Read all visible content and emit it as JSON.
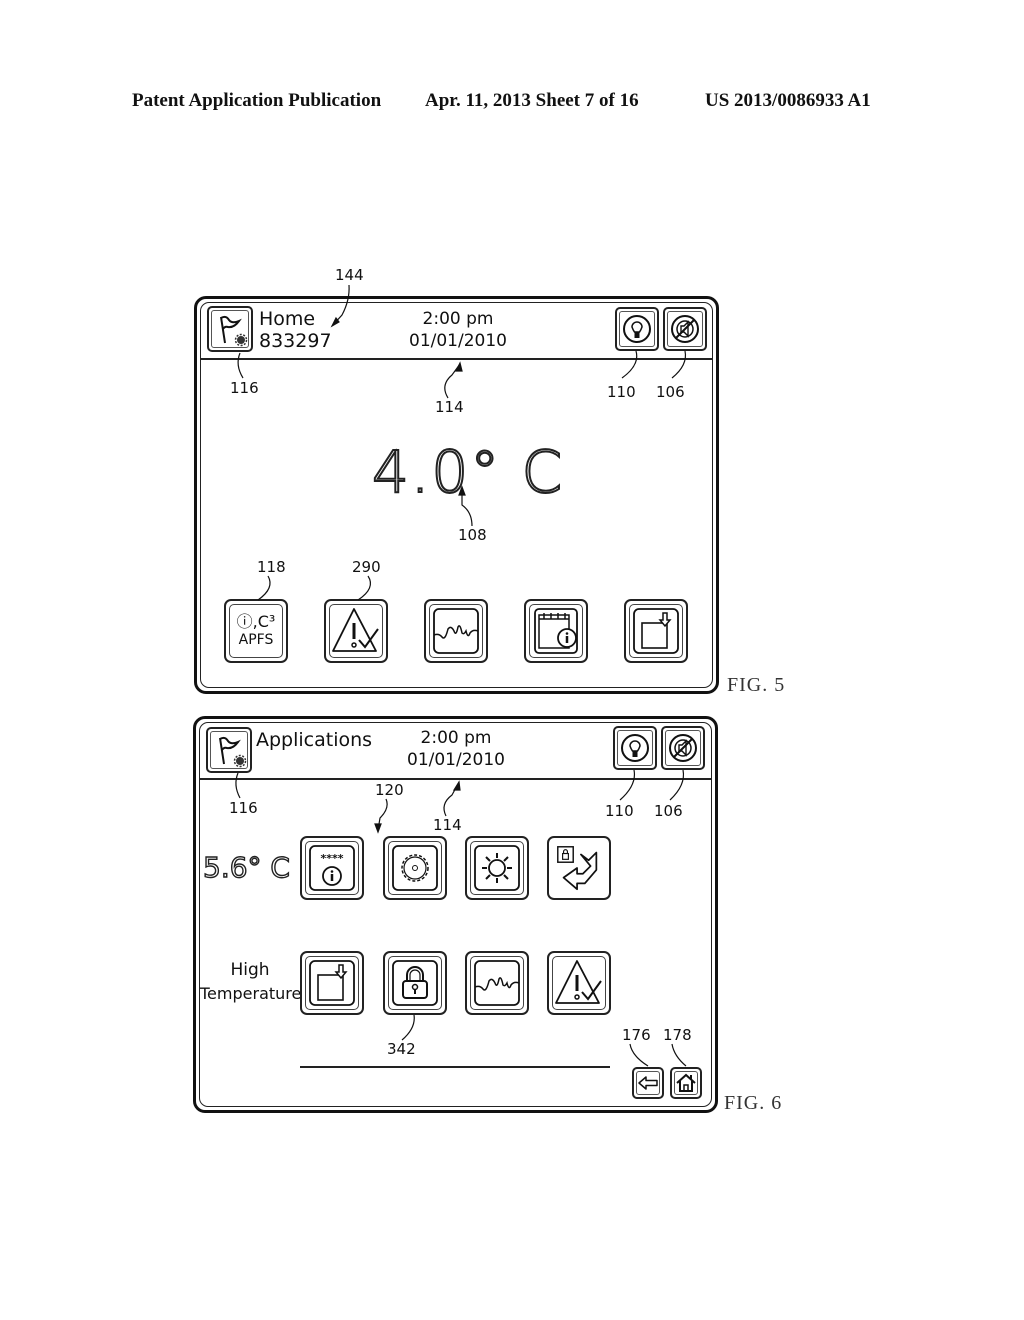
{
  "header": {
    "publication": "Patent Application Publication",
    "date_sheet": "Apr. 11, 2013  Sheet 7 of 16",
    "number": "US 2013/0086933 A1"
  },
  "fig5": {
    "label": "FIG. 5",
    "screen": {
      "title": "Home",
      "subtitle": "833297",
      "time": "2:00 pm",
      "date": "01/01/2010",
      "temperature": "4.0° C",
      "icons": {
        "menu": "flag-gear-icon",
        "light": "lightbulb-icon",
        "mute": "mute-speaker-icon"
      },
      "apps": [
        {
          "icon": "apfs-icon",
          "line1": "ⓘ,C³",
          "line2": "APFS"
        },
        {
          "icon": "alarm-acknowledge-icon"
        },
        {
          "icon": "graph-icon"
        },
        {
          "icon": "calendar-info-icon"
        },
        {
          "icon": "download-icon"
        }
      ]
    },
    "refs": {
      "r144": "144",
      "r116": "116",
      "r114": "114",
      "r110": "110",
      "r106": "106",
      "r108": "108",
      "r118": "118",
      "r290": "290"
    }
  },
  "fig6": {
    "label": "FIG. 6",
    "screen": {
      "title": "Applications",
      "time": "2:00 pm",
      "date": "01/01/2010",
      "temperature": "5.6° C",
      "status_line1": "High",
      "status_line2": "Temperature",
      "icons": {
        "menu": "flag-gear-icon",
        "light": "lightbulb-icon",
        "mute": "mute-speaker-icon",
        "back": "back-arrow-icon",
        "home": "home-icon"
      },
      "apps_row1": [
        {
          "icon": "password-info-icon",
          "text": "****"
        },
        {
          "icon": "settings-gear-icon"
        },
        {
          "icon": "brightness-icon"
        },
        {
          "icon": "lock-return-icon"
        }
      ],
      "apps_row2": [
        {
          "icon": "download-icon"
        },
        {
          "icon": "lock-icon"
        },
        {
          "icon": "graph-icon"
        },
        {
          "icon": "alarm-acknowledge-icon"
        }
      ]
    },
    "refs": {
      "r116": "116",
      "r120": "120",
      "r114": "114",
      "r110": "110",
      "r106": "106",
      "r342": "342",
      "r176": "176",
      "r178": "178"
    }
  }
}
